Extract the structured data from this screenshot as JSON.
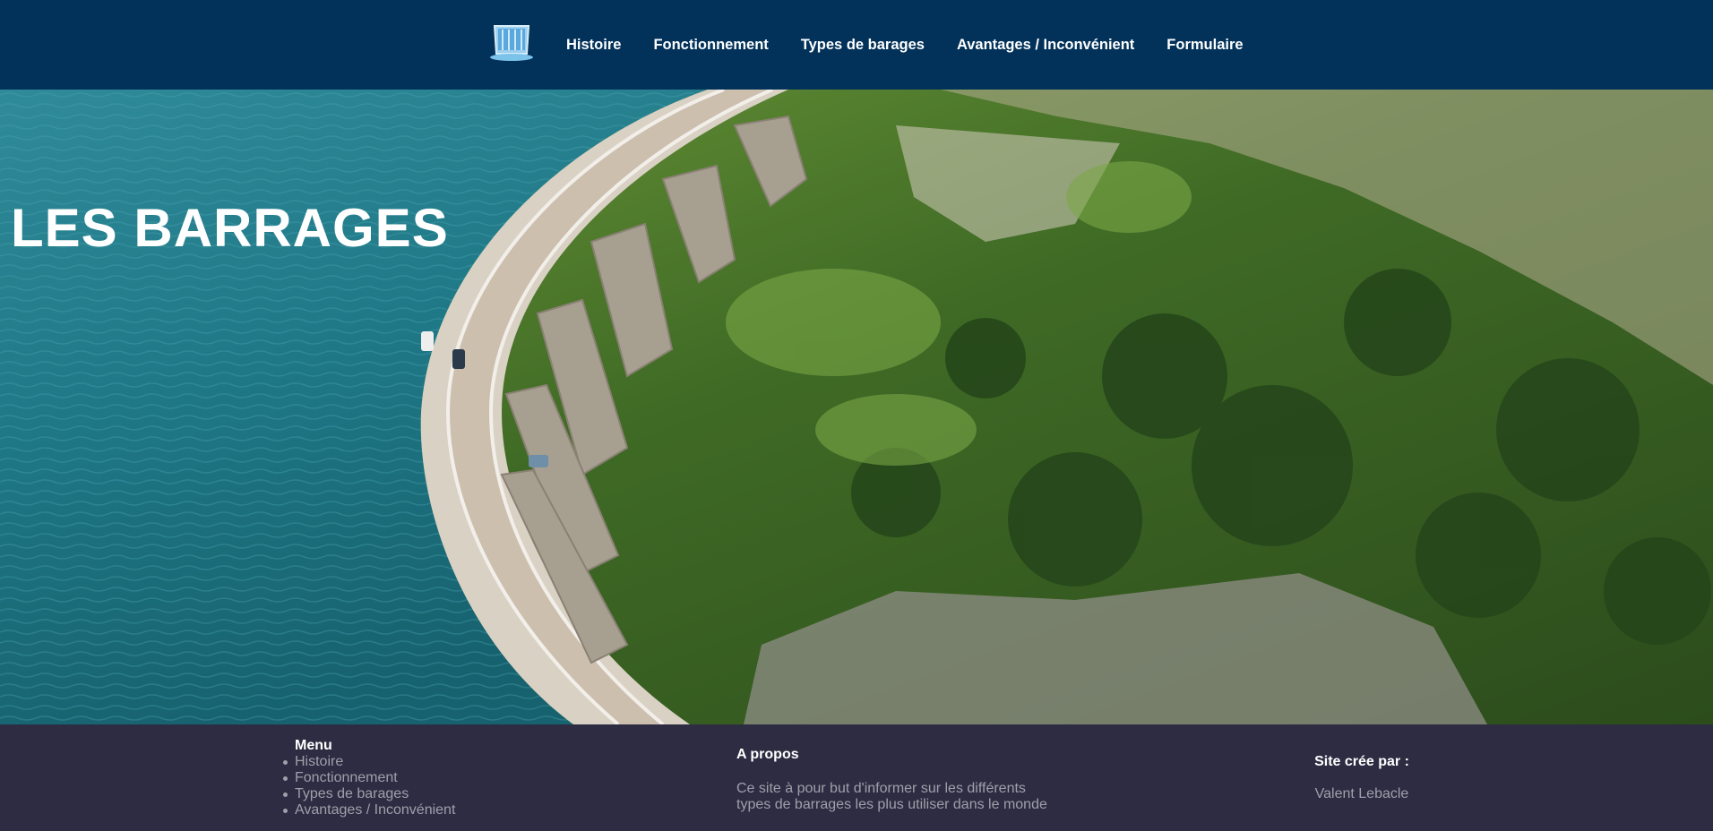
{
  "nav": {
    "logo_icon": "dam-logo-icon",
    "items": [
      "Histoire",
      "Fonctionnement",
      "Types de barages",
      "Avantages / Inconvénient",
      "Formulaire"
    ]
  },
  "hero": {
    "title": "LES BARRAGES",
    "image": "dam-aerial-photo"
  },
  "footer": {
    "menu": {
      "heading": "Menu",
      "items": [
        "Histoire",
        "Fonctionnement",
        "Types de barages",
        "Avantages / Inconvénient"
      ]
    },
    "about": {
      "heading": "A propos",
      "text_line1": "Ce site à pour but d'informer sur les différents",
      "text_line2": "types de barrages les plus utiliser dans le monde"
    },
    "credit": {
      "heading": "Site crée par :",
      "author": "Valent Lebacle"
    }
  },
  "colors": {
    "topbar": "#02325a",
    "footer": "#2d2c42",
    "footer_text_muted": "#9da0aa"
  }
}
